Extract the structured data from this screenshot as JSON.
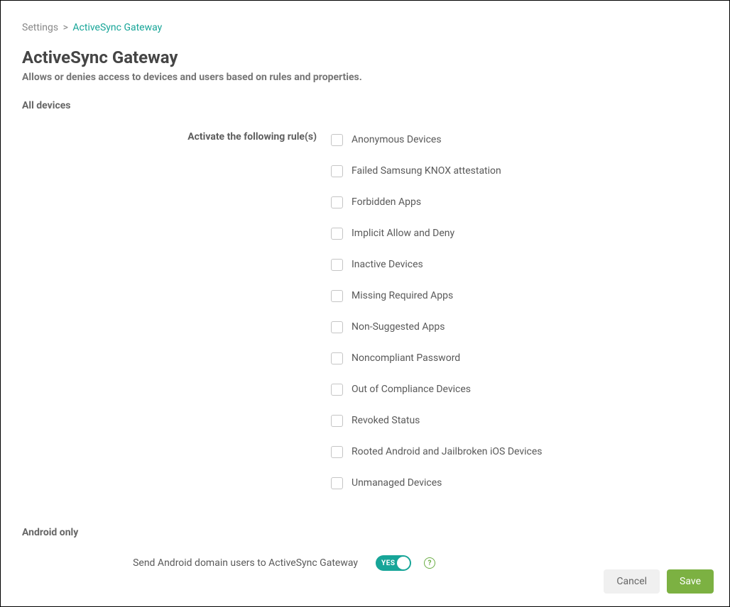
{
  "breadcrumb": {
    "root": "Settings",
    "separator": ">",
    "current": "ActiveSync Gateway"
  },
  "page": {
    "title": "ActiveSync Gateway",
    "subtitle": "Allows or denies access to devices and users based on rules and properties."
  },
  "sections": {
    "all_devices": {
      "header": "All devices",
      "rules_label": "Activate the following rule(s)",
      "rules": [
        {
          "label": "Anonymous Devices",
          "checked": false
        },
        {
          "label": "Failed Samsung KNOX attestation",
          "checked": false
        },
        {
          "label": "Forbidden Apps",
          "checked": false
        },
        {
          "label": "Implicit Allow and Deny",
          "checked": false
        },
        {
          "label": "Inactive Devices",
          "checked": false
        },
        {
          "label": "Missing Required Apps",
          "checked": false
        },
        {
          "label": "Non-Suggested Apps",
          "checked": false
        },
        {
          "label": "Noncompliant Password",
          "checked": false
        },
        {
          "label": "Out of Compliance Devices",
          "checked": false
        },
        {
          "label": "Revoked Status",
          "checked": false
        },
        {
          "label": "Rooted Android and Jailbroken iOS Devices",
          "checked": false
        },
        {
          "label": "Unmanaged Devices",
          "checked": false
        }
      ]
    },
    "android_only": {
      "header": "Android only",
      "setting_label": "Send Android domain users to ActiveSync Gateway",
      "toggle_value": "YES",
      "toggle_on": true
    }
  },
  "buttons": {
    "cancel": "Cancel",
    "save": "Save"
  }
}
